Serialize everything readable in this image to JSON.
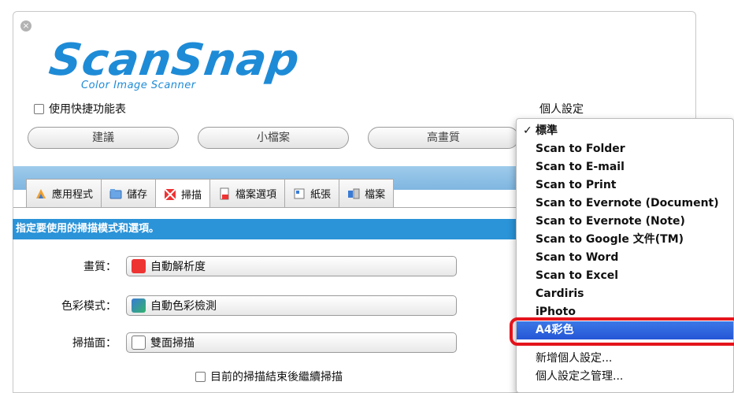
{
  "window": {
    "close_glyph": "×",
    "logo": {
      "title": "ScanSnap",
      "subtitle": "Color Image Scanner"
    }
  },
  "quick_menu": {
    "label": "使用快捷功能表",
    "checked": false
  },
  "profile": {
    "label": "個人設定"
  },
  "presets": [
    "建議",
    "小檔案",
    "高畫質"
  ],
  "tabs": [
    {
      "label": "應用程式",
      "icon": "application-icon",
      "active": false
    },
    {
      "label": "儲存",
      "icon": "save-folder-icon",
      "active": false
    },
    {
      "label": "掃描",
      "icon": "scan-icon",
      "active": true
    },
    {
      "label": "檔案選項",
      "icon": "file-option-icon",
      "active": false
    },
    {
      "label": "紙張",
      "icon": "paper-icon",
      "active": false
    },
    {
      "label": "檔案",
      "icon": "compression-icon",
      "active": false
    }
  ],
  "scan": {
    "section_title": "指定要使用的掃描模式和選項。",
    "image_quality": {
      "label": "畫質：",
      "value": "自動解析度",
      "icon": "auto-resolution-icon"
    },
    "color_mode": {
      "label": "色彩模式：",
      "value": "自動色彩檢測",
      "icon": "auto-color-icon"
    },
    "scan_side": {
      "label": "掃描面：",
      "value": "雙面掃描",
      "icon": "duplex-icon"
    },
    "continue_scan": {
      "label": "目前的掃描結束後繼續掃描",
      "checked": false
    }
  },
  "dropdown": {
    "items": [
      {
        "label": "標準",
        "checked": true
      },
      {
        "label": "Scan to Folder"
      },
      {
        "label": "Scan to E-mail"
      },
      {
        "label": "Scan to Print"
      },
      {
        "label": "Scan to Evernote (Document)"
      },
      {
        "label": "Scan to Evernote (Note)"
      },
      {
        "label": "Scan to Google 文件(TM)"
      },
      {
        "label": "Scan to Word"
      },
      {
        "label": "Scan to Excel"
      },
      {
        "label": "Cardiris"
      },
      {
        "label": "iPhoto"
      },
      {
        "label": "A4彩色",
        "selected": true
      }
    ],
    "actions": [
      "新增個人設定...",
      "個人設定之管理..."
    ],
    "check_glyph": "✓"
  },
  "colors": {
    "accent": "#2b93d8",
    "selection": "#2556d6",
    "highlight": "#e4141c"
  }
}
